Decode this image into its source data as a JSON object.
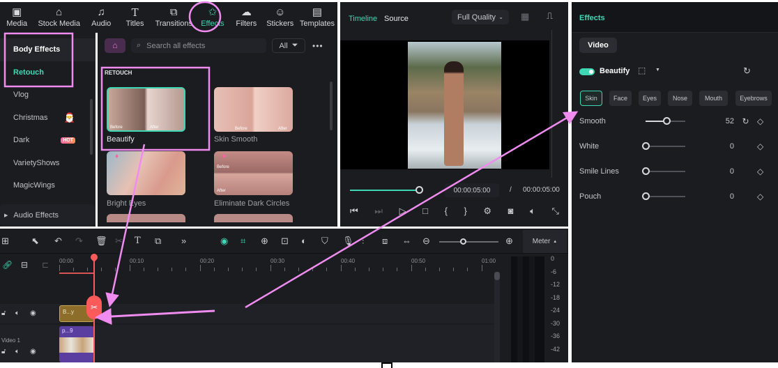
{
  "nav": {
    "tabs": [
      {
        "label": "Media",
        "icon": "media-icon"
      },
      {
        "label": "Stock Media",
        "icon": "stock-media-icon"
      },
      {
        "label": "Audio",
        "icon": "music-note-icon"
      },
      {
        "label": "Titles",
        "icon": "titles-icon"
      },
      {
        "label": "Transitions",
        "icon": "transitions-icon"
      },
      {
        "label": "Effects",
        "icon": "effects-star-icon",
        "active": true
      },
      {
        "label": "Filters",
        "icon": "filters-icon"
      },
      {
        "label": "Stickers",
        "icon": "stickers-icon"
      },
      {
        "label": "Templates",
        "icon": "templates-icon"
      }
    ]
  },
  "sidebar": {
    "items": [
      {
        "label": "Body Effects"
      },
      {
        "label": "Retouch"
      },
      {
        "label": "Vlog"
      },
      {
        "label": "Christmas"
      },
      {
        "label": "Dark",
        "badge": "HOT"
      },
      {
        "label": "VarietyShows"
      },
      {
        "label": "MagicWings"
      }
    ],
    "audio_effects": "Audio Effects"
  },
  "effects": {
    "search_placeholder": "Search all effects",
    "filter_label": "All",
    "section": "RETOUCH",
    "items": [
      {
        "name": "Beautify",
        "before": "Before",
        "after": "After"
      },
      {
        "name": "Skin Smooth",
        "before": "Before",
        "after": "After"
      },
      {
        "name": "Bright Eyes"
      },
      {
        "name": "Eliminate Dark Circles",
        "before": "Before",
        "after": "After"
      }
    ]
  },
  "preview": {
    "tabs": [
      "Timeline",
      "Source"
    ],
    "quality": "Full Quality",
    "current_time": "00:00:05:00",
    "separator": "/",
    "total_time": "00:00:05:00",
    "progress": 1.0
  },
  "right": {
    "title": "Effects",
    "tab": "Video",
    "effect_name": "Beautify",
    "enabled": true,
    "chips": [
      "Skin",
      "Face",
      "Eyes",
      "Nose",
      "Mouth",
      "Eyebrows"
    ],
    "params": [
      {
        "name": "Smooth",
        "value": "52",
        "fraction": 0.52
      },
      {
        "name": "White",
        "value": "0",
        "fraction": 0
      },
      {
        "name": "Smile Lines",
        "value": "0",
        "fraction": 0
      },
      {
        "name": "Pouch",
        "value": "0",
        "fraction": 0
      }
    ]
  },
  "timeline": {
    "meter": "Meter",
    "ruler": [
      "00:00",
      "00:10",
      "00:20",
      "00:30",
      "00:40",
      "00:50",
      "01:00"
    ],
    "db": [
      "0",
      "-6",
      "-12",
      "-18",
      "-24",
      "-30",
      "-36",
      "-42"
    ],
    "effect_clip": "B...y",
    "video_clip": "p...9",
    "track_label": "Video 1"
  },
  "colors": {
    "accent": "#3fd8b4",
    "annotation": "#f08cf0",
    "playhead": "#ff5a5a"
  }
}
